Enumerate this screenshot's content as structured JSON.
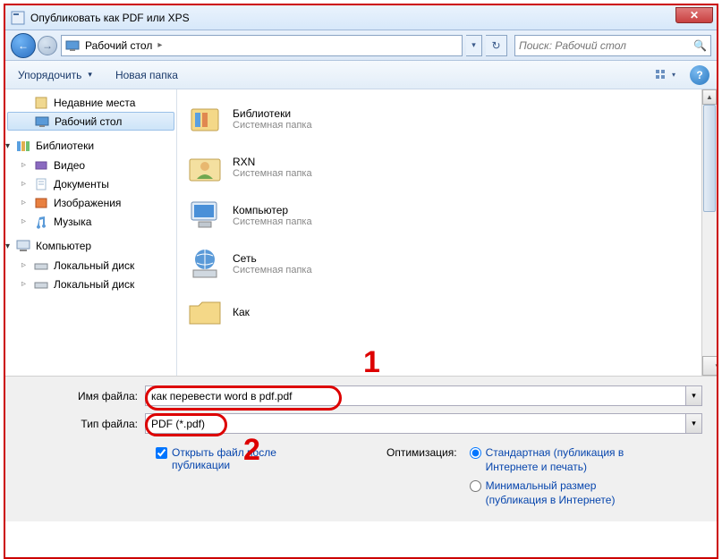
{
  "window": {
    "title": "Опубликовать как PDF или XPS",
    "close_glyph": "✕"
  },
  "addressbar": {
    "location": "Рабочий стол",
    "sep": "▸",
    "search_placeholder": "Поиск: Рабочий стол"
  },
  "toolbar": {
    "organize": "Упорядочить",
    "new_folder": "Новая папка",
    "help_glyph": "?"
  },
  "sidebar": {
    "recent": "Недавние места",
    "desktop": "Рабочий стол",
    "libraries": "Библиотеки",
    "video": "Видео",
    "documents": "Документы",
    "images": "Изображения",
    "music": "Музыка",
    "computer": "Компьютер",
    "local_c": "Локальный диск",
    "local_d": "Локальный диск"
  },
  "files": {
    "sub_folder": "Системная папка",
    "libraries": "Библиотеки",
    "rxn": "RXN",
    "computer": "Компьютер",
    "network": "Сеть",
    "kak": "Как"
  },
  "fields": {
    "filename_label": "Имя файла:",
    "filename_value": "как перевести word в pdf.pdf",
    "filetype_label": "Тип файла:",
    "filetype_value": "PDF (*.pdf)"
  },
  "options": {
    "open_after": "Открыть файл после публикации",
    "optimize_label": "Оптимизация:",
    "standard": "Стандартная (публикация в Интернете и печать)",
    "minimal": "Минимальный размер (публикация в Интернете)"
  },
  "annotations": {
    "one": "1",
    "two": "2"
  }
}
